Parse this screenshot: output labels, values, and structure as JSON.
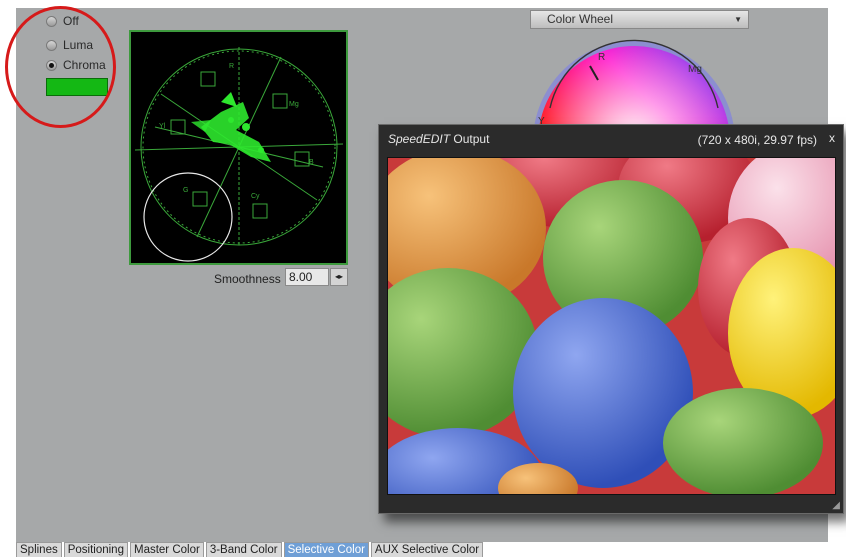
{
  "mode_radios": [
    {
      "label": "Off",
      "selected": false
    },
    {
      "label": "Luma",
      "selected": false
    },
    {
      "label": "Chroma",
      "selected": true
    }
  ],
  "colors": {
    "swatch": "#14b814",
    "scope_trace": "#2ee82e",
    "annotation_circle": "#d61a1a",
    "active_tab": "#6f9fd6"
  },
  "vectorscope": {
    "targets": [
      "R",
      "Mg",
      "B",
      "Cy",
      "G",
      "Yl"
    ]
  },
  "smoothness": {
    "label": "Smoothness",
    "value": "8.00"
  },
  "color_wheel": {
    "dropdown_value": "Color Wheel",
    "labels": [
      "R",
      "Mg",
      "Y"
    ]
  },
  "output_window": {
    "title_italic": "SpeedEDIT",
    "title_rest": " Output",
    "resolution": "(720 x 480i, 29.97 fps)",
    "close_label": "x"
  },
  "tabs": [
    {
      "label": "Splines",
      "active": false
    },
    {
      "label": "Positioning",
      "active": false
    },
    {
      "label": "Master Color",
      "active": false
    },
    {
      "label": "3-Band Color",
      "active": false
    },
    {
      "label": "Selective Color",
      "active": true
    },
    {
      "label": "AUX Selective Color",
      "active": false
    }
  ]
}
